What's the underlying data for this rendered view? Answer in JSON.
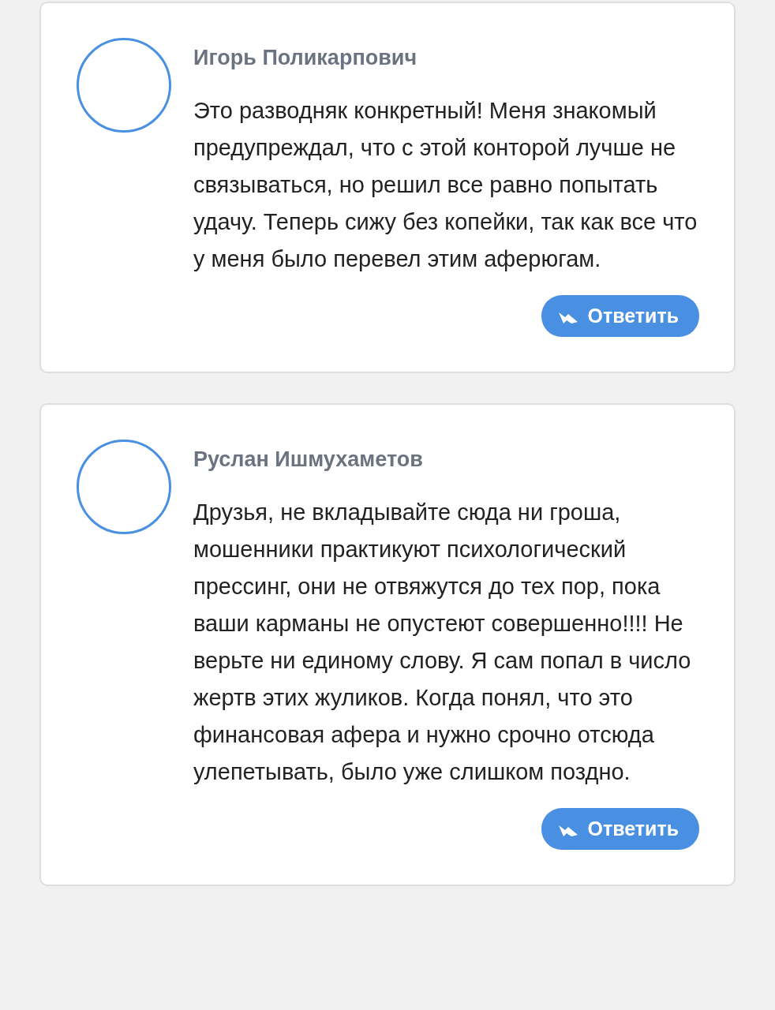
{
  "comments": [
    {
      "author": "Игорь Поликарпович",
      "text": "Это разводняк конкретный! Меня знакомый предупреждал, что с этой конторой лучше не связываться, но решил все равно попытать удачу. Теперь сижу без копейки, так как все что у меня было перевел этим аферюгам.",
      "reply_label": "Ответить"
    },
    {
      "author": "Руслан Ишмухаметов",
      "text": "Друзья, не вкладывайте сюда ни гроша, мошенники практикуют психологический прессинг, они не отвяжутся до тех пор, пока ваши карманы не опустеют совершенно!!!! Не верьте ни единому слову. Я сам попал в число жертв этих жуликов. Когда понял, что это финансовая афера и нужно срочно отсюда улепетывать, было уже слишком поздно.",
      "reply_label": "Ответить"
    }
  ]
}
